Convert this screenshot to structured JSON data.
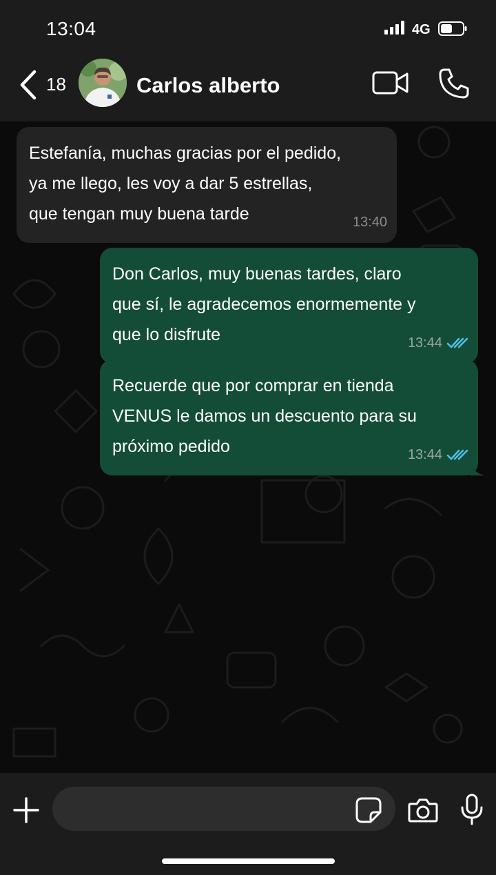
{
  "status_bar": {
    "time": "13:04",
    "network": "4G"
  },
  "header": {
    "back_count": "18",
    "contact_name": "Carlos alberto"
  },
  "messages": [
    {
      "direction": "incoming",
      "text": "Estefanía, muchas gracias por el pedido,\nya me llego, les voy a dar 5 estrellas,\nque tengan muy buena tarde",
      "time": "13:40"
    },
    {
      "direction": "outgoing",
      "text": "Don Carlos, muy buenas tardes, claro\nque sí, le agradecemos enormemente y\nque lo disfrute",
      "time": "13:44",
      "status": "read"
    },
    {
      "direction": "outgoing",
      "text": "Recuerde que por comprar en tienda\nVENUS le damos un descuento para su\npróximo pedido",
      "time": "13:44",
      "status": "read"
    }
  ],
  "composer": {
    "placeholder": ""
  },
  "colors": {
    "bar_background": "#1c1c1c",
    "chat_background": "#0b0b0b",
    "incoming_bubble": "#232323",
    "outgoing_bubble": "#144d37",
    "read_ticks": "#53bdeb"
  },
  "icons": [
    "back-chevron-icon",
    "avatar",
    "video-call-icon",
    "phone-call-icon",
    "plus-icon",
    "sticker-icon",
    "camera-icon",
    "microphone-icon",
    "double-check-icon"
  ]
}
